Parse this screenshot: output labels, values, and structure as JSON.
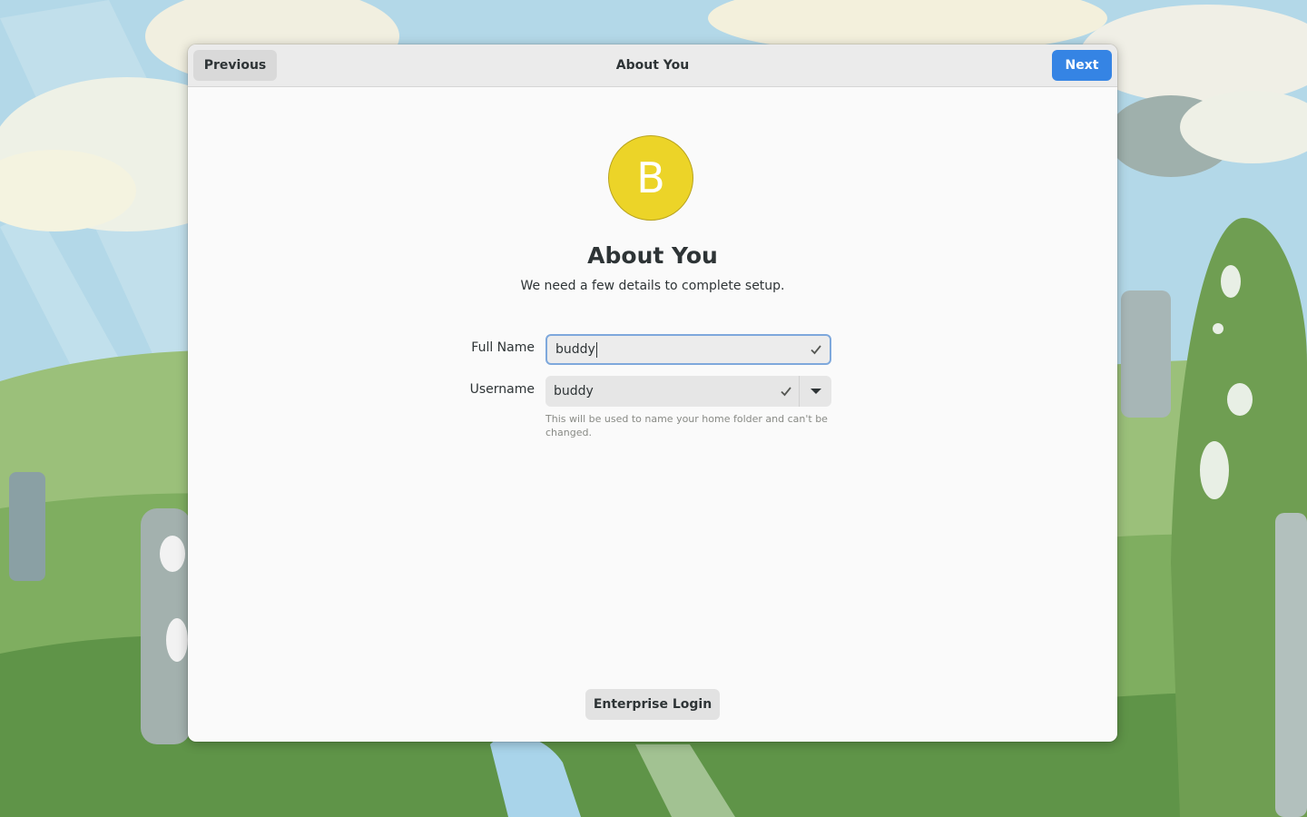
{
  "header": {
    "previous_label": "Previous",
    "title": "About You",
    "next_label": "Next"
  },
  "avatar": {
    "initial": "B",
    "color": "#ecd428"
  },
  "page": {
    "title": "About You",
    "subtitle": "We need a few details to complete setup."
  },
  "form": {
    "full_name_label": "Full Name",
    "full_name_value": "buddy",
    "username_label": "Username",
    "username_value": "buddy",
    "username_hint": "This will be used to name your home folder and can't be changed."
  },
  "footer": {
    "enterprise_login_label": "Enterprise Login"
  },
  "colors": {
    "accent": "#3584e4",
    "focus_border": "#7ea8dc"
  },
  "icons": {
    "full_name_valid": "check-icon",
    "username_valid": "check-icon",
    "username_dropdown": "chevron-down-icon"
  }
}
